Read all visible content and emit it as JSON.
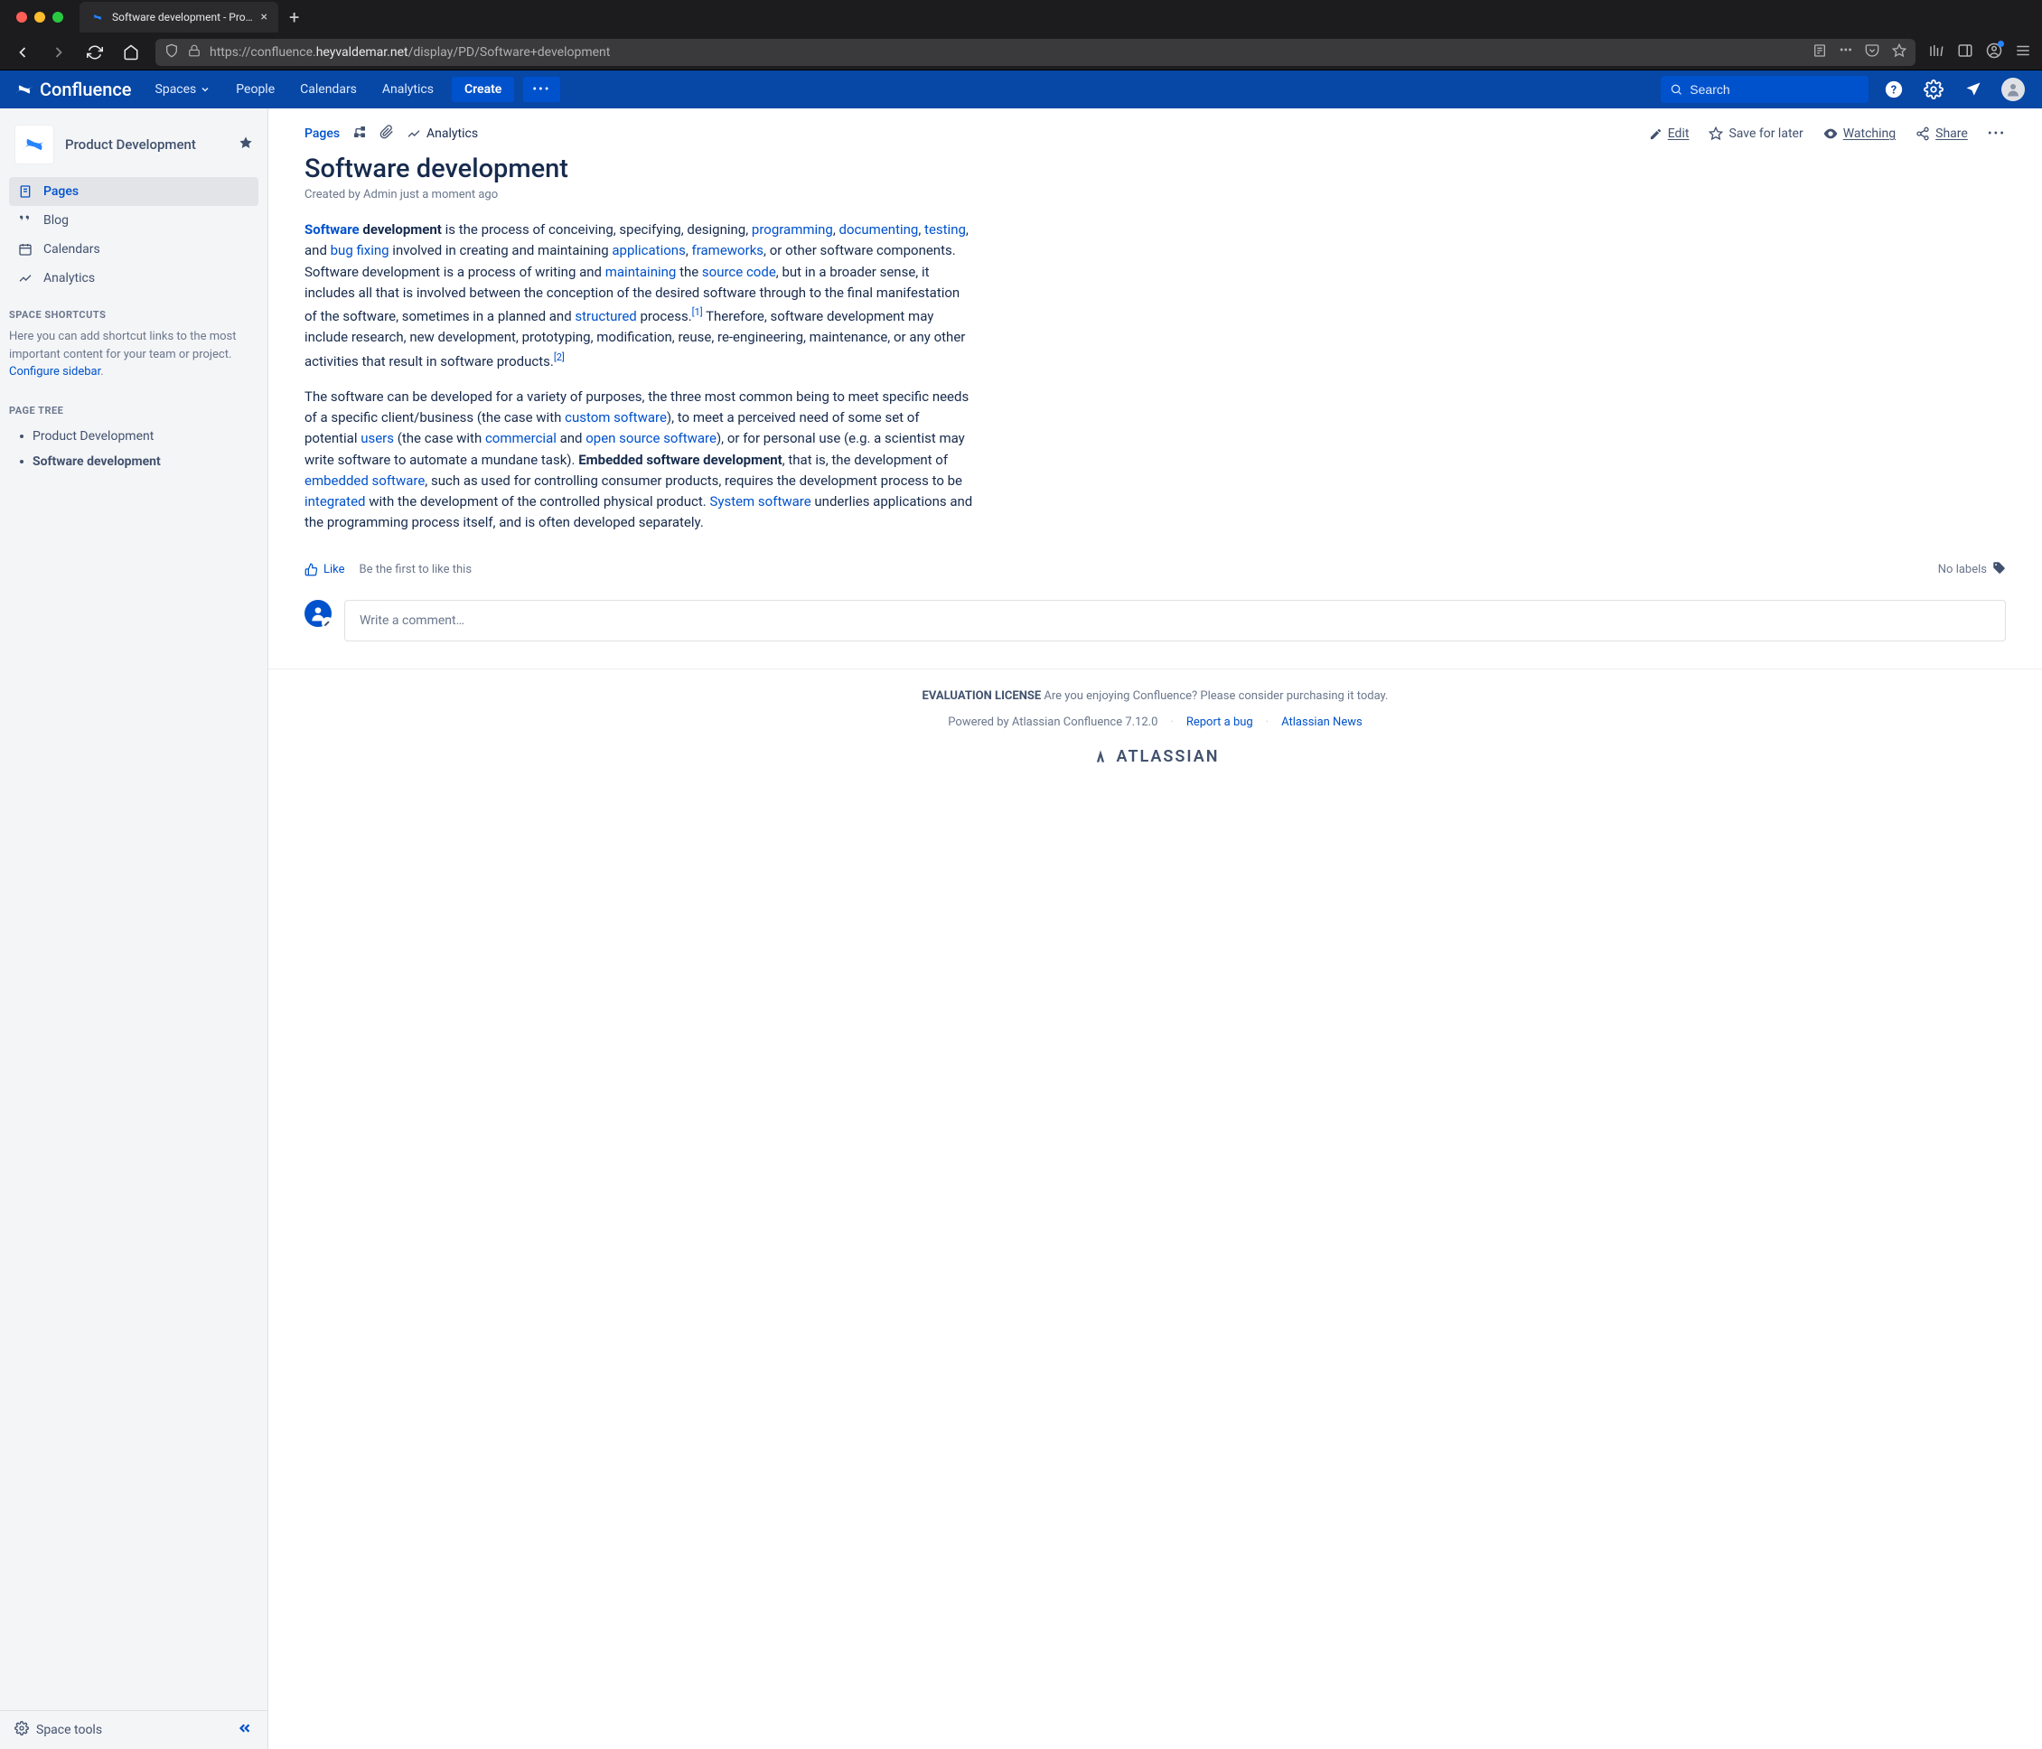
{
  "browser": {
    "tab_title": "Software development - Produc",
    "url_prefix": "https://confluence.",
    "url_host": "heyvaldemar.net",
    "url_path": "/display/PD/Software+development"
  },
  "top_nav": {
    "logo": "Confluence",
    "items": [
      "Spaces",
      "People",
      "Calendars",
      "Analytics"
    ],
    "create": "Create",
    "more": "•••",
    "search_placeholder": "Search"
  },
  "sidebar": {
    "space_name": "Product Development",
    "nav": [
      {
        "label": "Pages",
        "icon": "page"
      },
      {
        "label": "Blog",
        "icon": "quote"
      },
      {
        "label": "Calendars",
        "icon": "calendar"
      },
      {
        "label": "Analytics",
        "icon": "analytics"
      }
    ],
    "shortcuts_heading": "SPACE SHORTCUTS",
    "shortcuts_text": "Here you can add shortcut links to the most important content for your team or project. ",
    "shortcuts_link": "Configure sidebar",
    "tree_heading": "PAGE TREE",
    "tree": [
      {
        "label": "Product Development",
        "current": false
      },
      {
        "label": "Software development",
        "current": true
      }
    ],
    "footer": "Space tools"
  },
  "page": {
    "breadcrumb": "Pages",
    "analytics_label": "Analytics",
    "actions": {
      "edit": "Edit",
      "save": "Save for later",
      "watch": "Watching",
      "share": "Share"
    },
    "title": "Software development",
    "meta": "Created by Admin just a moment ago",
    "like": "Like",
    "like_text": "Be the first to like this",
    "no_labels": "No labels",
    "comment_placeholder": "Write a comment…"
  },
  "body": {
    "p1_1": "Software",
    "p1_2": " development",
    "p1_3": " is the process of conceiving, specifying, designing, ",
    "l_programming": "programming",
    "p1_4": ", ",
    "l_documenting": "documenting",
    "p1_5": ", ",
    "l_testing": "testing",
    "p1_6": ", and ",
    "l_bugfix": "bug fixing",
    "p1_7": " involved in creating and maintaining ",
    "l_apps": "applications",
    "p1_8": ", ",
    "l_frameworks": "frameworks",
    "p1_9": ", or other software components. Software development is a process of writing and ",
    "l_maintain": "maintaining",
    "p1_10": " the ",
    "l_source": "source code",
    "p1_11": ", but in a broader sense, it includes all that is involved between the conception of the desired software through to the final manifestation of the software, sometimes in a planned and ",
    "l_structured": "structured",
    "p1_12": " process.",
    "ref1": "[1]",
    "p1_13": " Therefore, software development may include research, new development, prototyping, modification, reuse, re-engineering, maintenance, or any other activities that result in software products.",
    "ref2": "[2]",
    "p2_1": "The software can be developed for a variety of purposes, the three most common being to meet specific needs of a specific client/business (the case with ",
    "l_custom": "custom software",
    "p2_2": "), to meet a perceived need of some set of potential ",
    "l_users": "users",
    "p2_3": " (the case with ",
    "l_commercial": "commercial",
    "p2_4": " and ",
    "l_opensource": "open source software",
    "p2_5": "), or for personal use (e.g. a scientist may write software to automate a mundane task). ",
    "p2_6": "Embedded software development",
    "p2_7": ", that is, the development of ",
    "l_embedded": "embedded software",
    "p2_8": ", such as used for controlling consumer products, requires the development process to be ",
    "l_integrated": "integrated",
    "p2_9": " with the development of the controlled physical product. ",
    "l_system": "System software",
    "p2_10": " underlies applications and the programming process itself, and is often developed separately."
  },
  "footer": {
    "eval_label": "EVALUATION LICENSE",
    "eval_text": " Are you enjoying Confluence? Please consider purchasing it today.",
    "powered": "Powered by Atlassian Confluence 7.12.0",
    "report": "Report a bug",
    "news": "Atlassian News",
    "brand": "ATLASSIAN"
  }
}
